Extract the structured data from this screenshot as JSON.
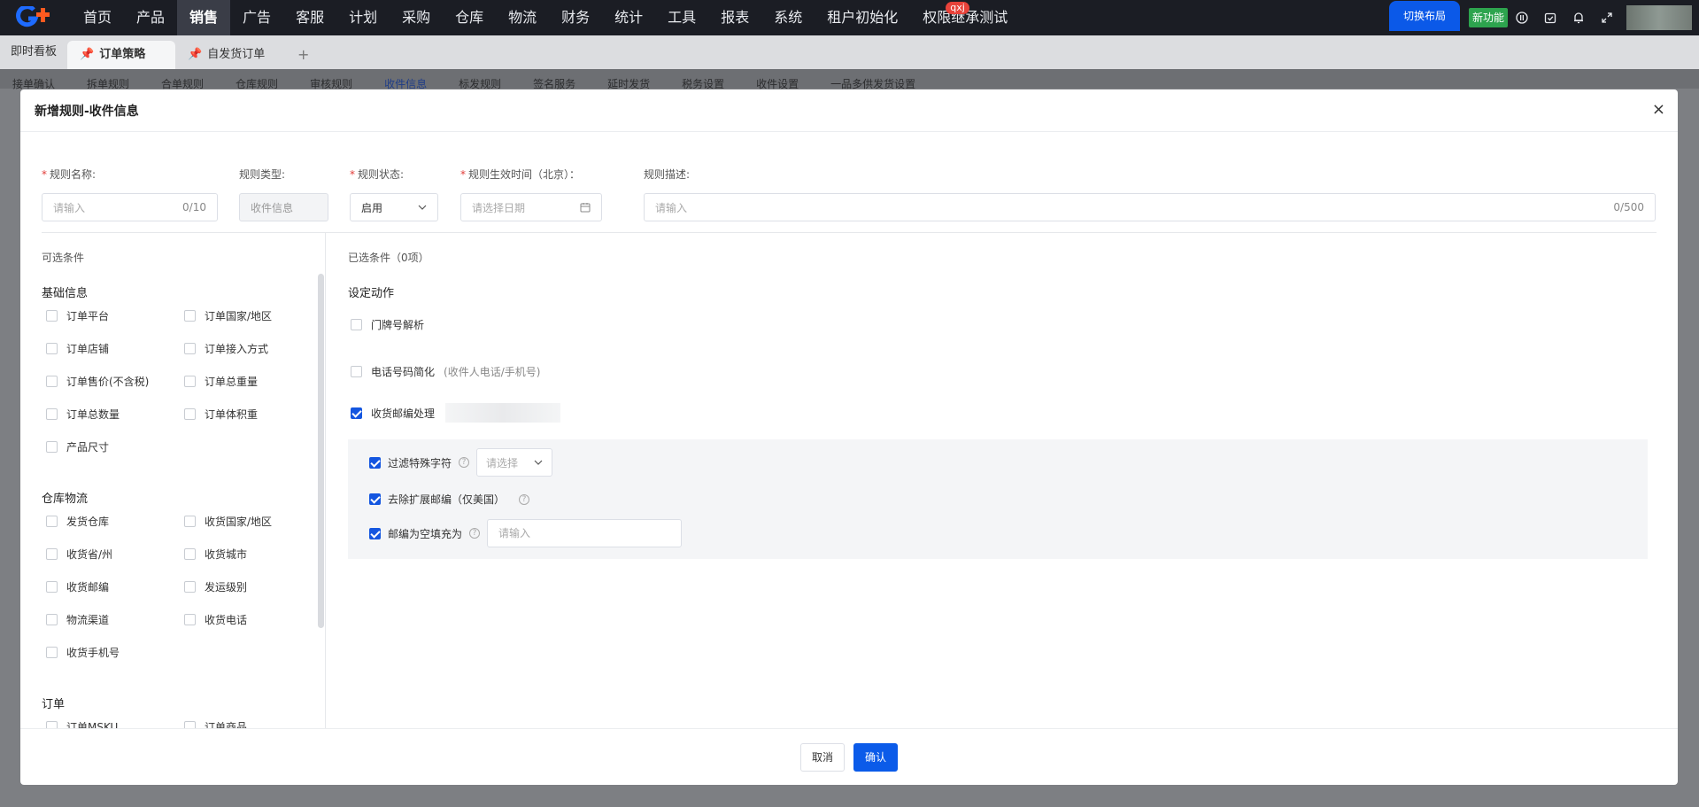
{
  "colors": {
    "nav_bg": "#1b1d24",
    "primary": "#0b5be9",
    "new_badge": "#2da44e",
    "required": "#e23c39"
  },
  "nav": {
    "items": [
      "首页",
      "产品",
      "销售",
      "广告",
      "客服",
      "计划",
      "采购",
      "仓库",
      "物流",
      "财务",
      "统计",
      "工具",
      "报表",
      "系统",
      "租户初始化",
      "权限继承测试"
    ],
    "active_index": 2,
    "badge": "qxj",
    "switch_layout": "切换布局",
    "new_feature": "新功能",
    "icons": [
      "info-icon",
      "check-calendar-icon",
      "bell-icon",
      "expand-icon"
    ]
  },
  "tabs": {
    "home": "即时看板",
    "items": [
      {
        "label": "订单策略",
        "active": true
      },
      {
        "label": "自发货订单",
        "active": false
      }
    ],
    "add": "+"
  },
  "subtabs": {
    "items": [
      "接单确认",
      "拆单规则",
      "合单规则",
      "仓库规则",
      "审核规则",
      "收件信息",
      "标发规则",
      "签名服务",
      "延时发货",
      "税务设置",
      "收件设置",
      "一品多供发货设置"
    ],
    "active_index": 5
  },
  "modal": {
    "title": "新增规则-收件信息",
    "close": "×",
    "form": {
      "name": {
        "label": "规则名称:",
        "placeholder": "请输入",
        "counter": "0/10",
        "required": true
      },
      "type": {
        "label": "规则类型:",
        "value": "收件信息"
      },
      "status": {
        "label": "规则状态:",
        "value": "启用",
        "required": true
      },
      "effective": {
        "label": "规则生效时间（北京）：",
        "placeholder": "请选择日期",
        "required": true
      },
      "desc": {
        "label": "规则描述:",
        "placeholder": "请输入",
        "counter": "0/500"
      }
    },
    "left": {
      "title": "可选条件",
      "groups": [
        {
          "title": "基础信息",
          "items": [
            "订单平台",
            "订单国家/地区",
            "订单店铺",
            "订单接入方式",
            "订单售价(不含税)",
            "订单总重量",
            "订单总数量",
            "订单体积重",
            "产品尺寸"
          ]
        },
        {
          "title": "仓库物流",
          "items": [
            "发货仓库",
            "收货国家/地区",
            "收货省/州",
            "收货城市",
            "收货邮编",
            "发运级别",
            "物流渠道",
            "收货电话",
            "收货手机号"
          ]
        },
        {
          "title": "订单",
          "items": [
            "订单MSKU",
            "订单商品"
          ]
        }
      ]
    },
    "right": {
      "title": "已选条件（0项）",
      "subtitle": "设定动作",
      "actions": [
        {
          "label": "门牌号解析",
          "checked": false
        },
        {
          "label": "电话号码简化",
          "hint": "(收件人电话/手机号)",
          "checked": false
        },
        {
          "label": "收货邮编处理",
          "checked": true
        }
      ],
      "sub_actions": [
        {
          "label": "过滤特殊字符",
          "select_placeholder": "请选择"
        },
        {
          "label": "去除扩展邮编（仅美国）"
        },
        {
          "label": "邮编为空填充为",
          "input_placeholder": "请输入"
        }
      ]
    },
    "footer": {
      "cancel": "取消",
      "confirm": "确认"
    }
  }
}
